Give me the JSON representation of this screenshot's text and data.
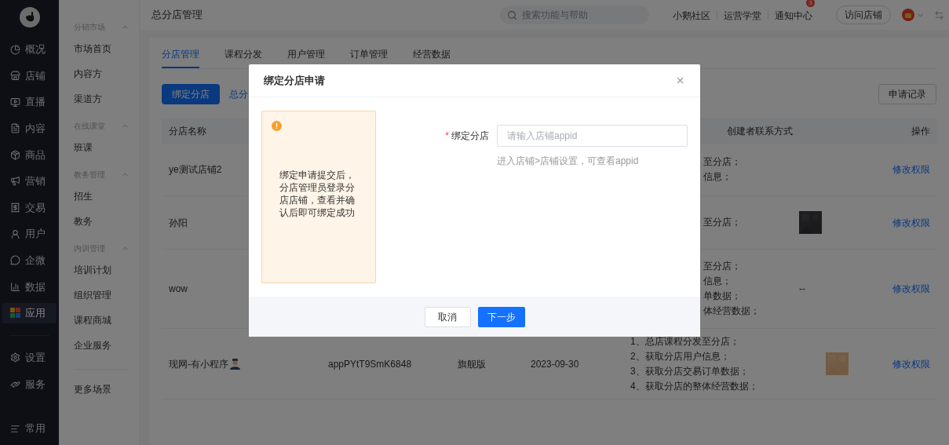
{
  "nav": {
    "main_items": [
      {
        "label": "概况",
        "selected": false
      },
      {
        "label": "店铺",
        "selected": false
      },
      {
        "label": "直播",
        "selected": false
      },
      {
        "label": "内容",
        "selected": false
      },
      {
        "label": "商品",
        "selected": false
      },
      {
        "label": "营销",
        "selected": false
      },
      {
        "label": "交易",
        "selected": false
      },
      {
        "label": "用户",
        "selected": false
      },
      {
        "label": "企微",
        "selected": false
      },
      {
        "label": "数据",
        "selected": false
      },
      {
        "label": "应用",
        "selected": true
      }
    ],
    "system_items": [
      {
        "label": "设置",
        "selected": false
      },
      {
        "label": "服务",
        "selected": false
      }
    ],
    "footer": "常用"
  },
  "subnav": {
    "groups": [
      {
        "title": "分销市场",
        "expanded": true,
        "items": [
          "市场首页",
          "内容方",
          "渠道方"
        ]
      },
      {
        "title": "在线课堂",
        "expanded": true,
        "items": [
          "班课"
        ]
      },
      {
        "title": "教务管理",
        "expanded": true,
        "items": [
          "招生",
          "教务"
        ]
      },
      {
        "title": "内训管理",
        "expanded": true,
        "items": [
          "培训计划",
          "组织管理",
          "课程商城",
          "企业服务"
        ]
      }
    ],
    "more": "更多场景"
  },
  "header": {
    "title": "总分店管理",
    "search": {
      "placeholder": "搜索功能与帮助"
    },
    "links": [
      "小鹅社区",
      "运营学堂",
      "通知中心"
    ],
    "notification_count": "3",
    "visit_button": "访问店铺"
  },
  "tabs": [
    {
      "label": "分店管理",
      "selected": true
    },
    {
      "label": "课程分发",
      "selected": false
    },
    {
      "label": "用户管理",
      "selected": false
    },
    {
      "label": "订单管理",
      "selected": false
    },
    {
      "label": "经营数据",
      "selected": false
    }
  ],
  "toolbar": {
    "primary_button": "绑定分店",
    "link": "总分",
    "records_button": "申请记录"
  },
  "table": {
    "columns": {
      "name": "分店名称",
      "contact": "创建者联系方式",
      "action": "操作"
    },
    "rows": [
      {
        "name": "ye测试店铺2",
        "name_icon": false,
        "permissions": [
          "至分店；",
          "信息；"
        ],
        "action": "修改权限"
      },
      {
        "name": "孙阳",
        "name_icon": false,
        "permissions": [
          "至分店；"
        ],
        "contact": {
          "kind": "picture"
        },
        "action": "修改权限"
      },
      {
        "name": "wow",
        "name_icon": false,
        "permissions": [
          "至分店；",
          "信息；",
          "单数据；",
          "体经营数据；"
        ],
        "contact": {
          "kind": "text",
          "text": "--"
        },
        "action": "修改权限"
      },
      {
        "name": "现网-有小程序",
        "name_icon": true,
        "appid": "appPYtT9SmK6848",
        "version": "旗舰版",
        "date": "2023-09-30",
        "permissions": [
          "1、总店课程分发至分店；",
          "2、获取分店用户信息；",
          "3、获取分店交易订单数据；",
          "4、获取分店的整体经营数据；"
        ],
        "contact": {
          "kind": "picture"
        },
        "action": "修改权限"
      }
    ]
  },
  "dialog": {
    "title": "绑定分店申请",
    "notice": "绑定申请提交后，分店管理员登录分店店铺，查看并确认后即可绑定成功",
    "field": {
      "label": "绑定分店",
      "required_mark": "*",
      "placeholder": "请输入店铺appid",
      "hint": "进入店铺>店铺设置，可查看appid"
    },
    "cancel_button": "取消",
    "next_button": "下一步"
  }
}
